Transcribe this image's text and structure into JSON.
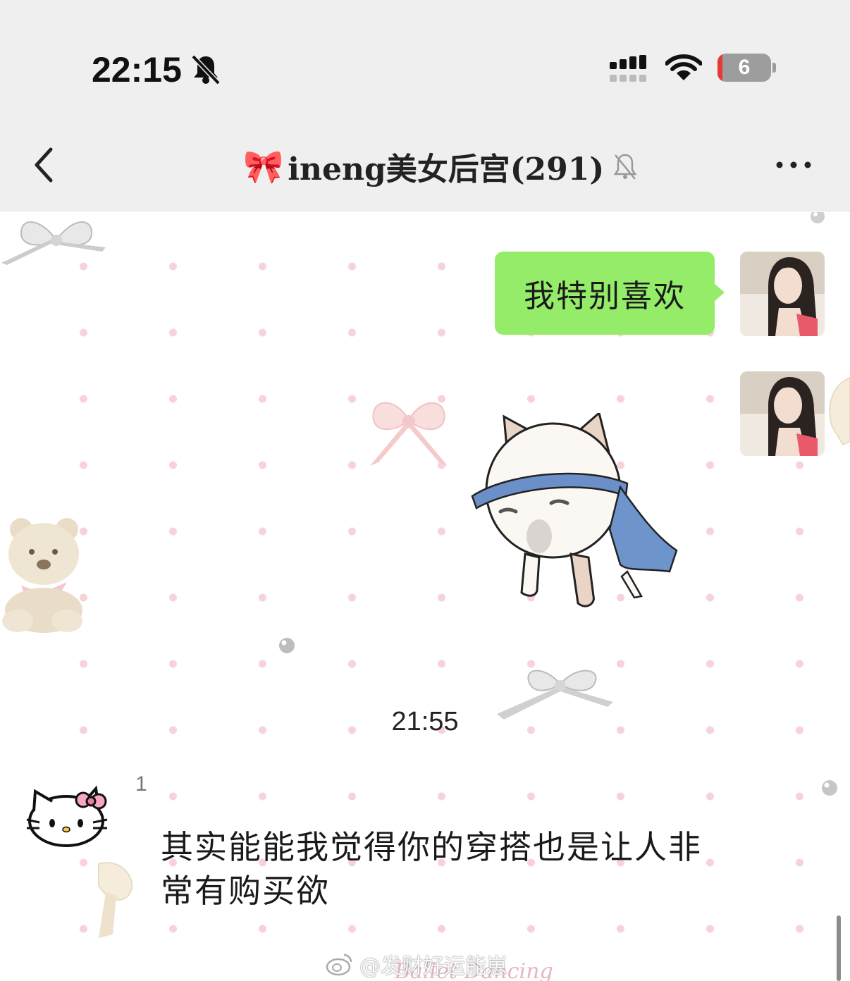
{
  "status_bar": {
    "time": "22:15",
    "battery_level": "6",
    "icons": [
      "bell-off-icon",
      "cellular-signal-icon",
      "wifi-icon",
      "battery-icon"
    ]
  },
  "nav": {
    "title_emoji": "🎀",
    "title": "ineng美女后宫(291)",
    "icons": [
      "back-chevron-icon",
      "mute-bell-icon",
      "more-dots-icon"
    ]
  },
  "messages": {
    "self_text": "我特别喜欢",
    "timestamp": "21:55",
    "sender_name": "1",
    "other_text": "其实能能我觉得你的穿搭也是让人非常有购买欲"
  },
  "watermark": {
    "text": "@发财好运能崽",
    "background_text": "Ballet Dancing"
  },
  "colors": {
    "bubble_self": "#95ec69",
    "status_bg": "#efefef",
    "dots": "#f7d3d9",
    "battery_low": "#e53935"
  }
}
